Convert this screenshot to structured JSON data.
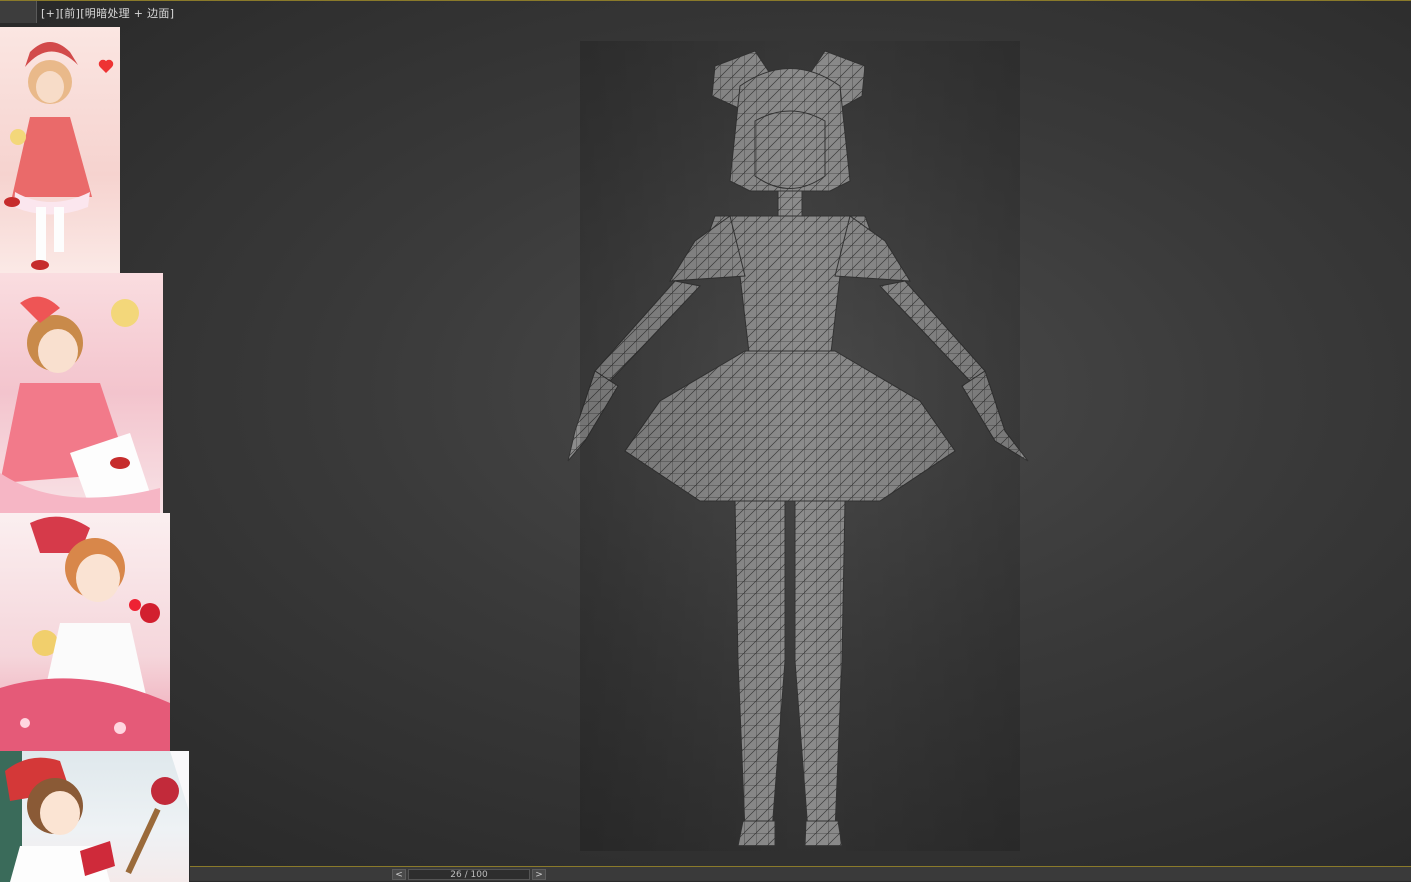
{
  "viewport": {
    "label_plus": "[+]",
    "label_view": "[前]",
    "label_shading": "[明暗处理 + 边面]"
  },
  "reference_images": [
    {
      "name": "sakura-reference-1"
    },
    {
      "name": "sakura-reference-2"
    },
    {
      "name": "sakura-reference-3"
    },
    {
      "name": "sakura-reference-4"
    }
  ],
  "model": {
    "name": "wireframe-character-model"
  },
  "timeline": {
    "prev_label": "<",
    "next_label": ">",
    "frame_label": "26 / 100",
    "current_frame": 26,
    "total_frames": 100
  },
  "colors": {
    "viewport_bg": "#3a3a3a",
    "active_border": "#8a7a2a",
    "model_fill": "#8a8a8a",
    "wire": "#3a3a3a"
  }
}
